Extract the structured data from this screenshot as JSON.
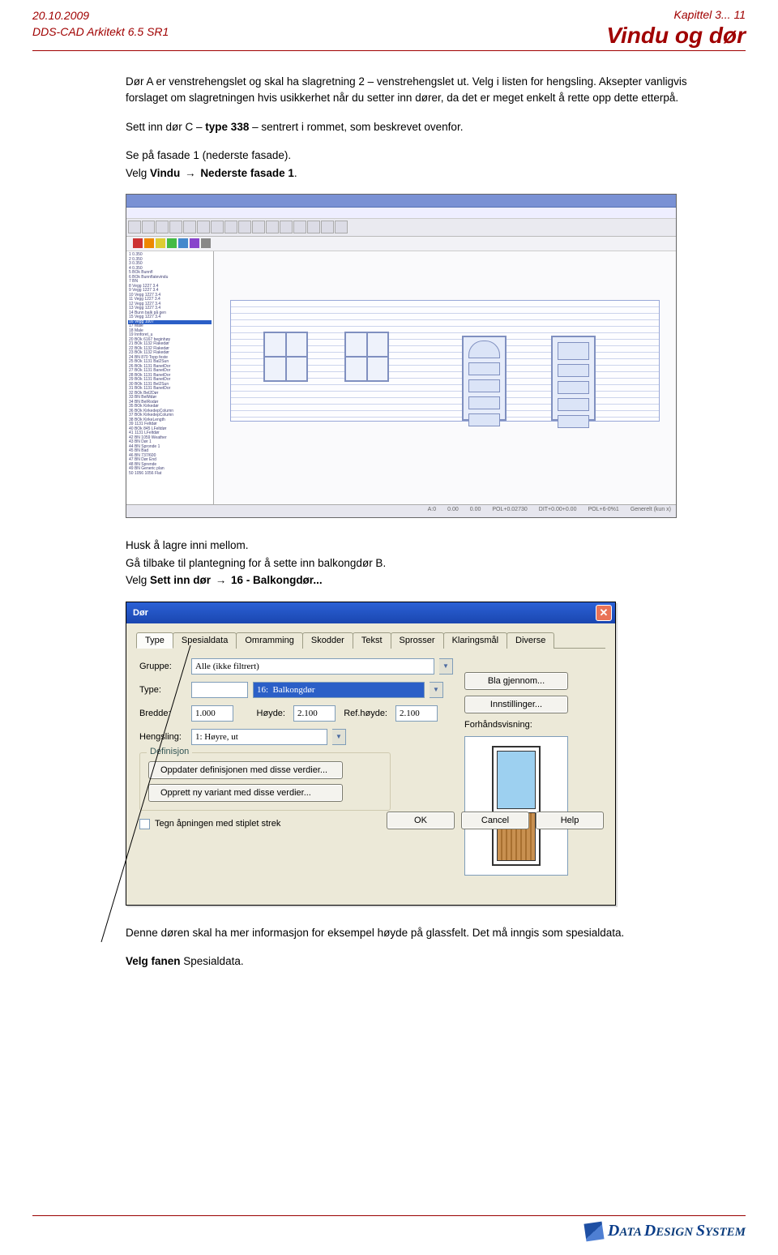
{
  "header": {
    "date": "20.10.2009",
    "subtitle": "DDS-CAD Arkitekt  6.5  SR1",
    "chapter": "Kapittel 3...  11",
    "title": "Vindu og dør"
  },
  "paragraphs": {
    "p1": "Dør A er venstrehengslet og skal ha slagretning 2 – venstrehengslet ut. Velg i listen for hengsling. Aksepter vanligvis forslaget om slagretningen hvis usikkerhet når du setter inn dører, da det er meget enkelt å rette opp dette etterpå.",
    "p2a": "Sett inn dør C – ",
    "p2b": "type 338",
    "p2c": " – sentrert i rommet, som beskrevet ovenfor.",
    "p3": "Se på fasade 1 (nederste fasade).",
    "p4a": "Velg ",
    "p4b": "Vindu",
    "p4c": "Nederste fasade 1",
    "p5": "Husk å lagre inni mellom.",
    "p6": "Gå tilbake til plantegning for å sette inn balkongdør B.",
    "p7a": "Velg ",
    "p7b": "Sett inn dør",
    "p7c": "16 - Balkongdør...",
    "p8": "Denne døren skal ha mer informasjon for eksempel høyde på glassfelt. Det må inngis som spesialdata.",
    "p9a": "Velg fanen ",
    "p9b": "Spesialdata."
  },
  "dialog": {
    "title": "Dør",
    "tabs": [
      "Type",
      "Spesialdata",
      "Omramming",
      "Skodder",
      "Tekst",
      "Sprosser",
      "Klaringsmål",
      "Diverse"
    ],
    "labels": {
      "gruppe": "Gruppe:",
      "type": "Type:",
      "bredde": "Bredde:",
      "hoyde": "Høyde:",
      "refhoyde": "Ref.høyde:",
      "hengsling": "Hengsling:",
      "definisjon": "Definisjon",
      "forhandsvisning": "Forhåndsvisning:"
    },
    "values": {
      "gruppe": "Alle (ikke filtrert)",
      "type_display": "16:  Balkongdør",
      "bredde": "1.000",
      "hoyde": "2.100",
      "refhoyde": "2.100",
      "hengsling": "1: Høyre, ut"
    },
    "buttons": {
      "bla": "Bla gjennom...",
      "innstillinger": "Innstillinger...",
      "oppdater": "Oppdater definisjonen med disse verdier...",
      "opprett": "Opprett ny variant med disse verdier...",
      "tegn_check": "Tegn åpningen med stiplet strek",
      "ok": "OK",
      "cancel": "Cancel",
      "help": "Help"
    }
  },
  "footer": {
    "brand": "DATA DESIGN SYSTEM"
  }
}
